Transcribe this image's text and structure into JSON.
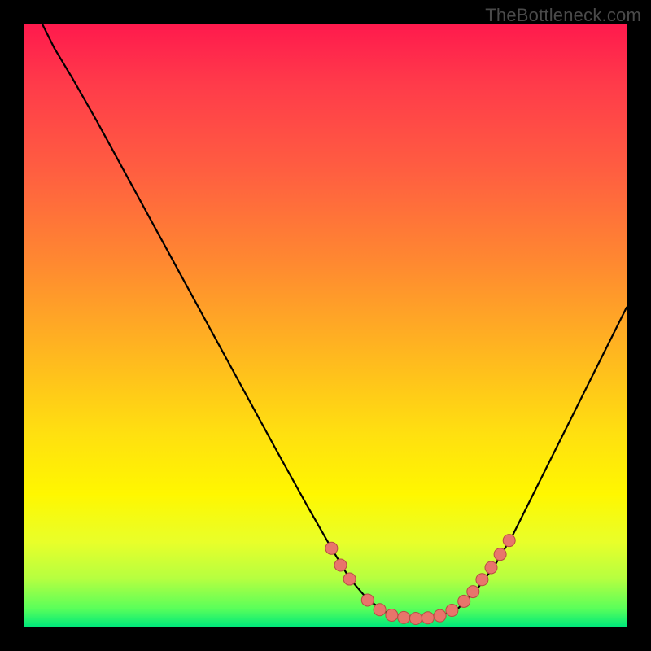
{
  "watermark": {
    "text": "TheBottleneck.com"
  },
  "colors": {
    "background": "#000000",
    "curve_stroke": "#000000",
    "dot_fill": "#e8756b",
    "dot_stroke": "#b84c44"
  },
  "chart_data": {
    "type": "line",
    "title": "",
    "xlabel": "",
    "ylabel": "",
    "xlim": [
      0,
      100
    ],
    "ylim": [
      0,
      100
    ],
    "grid": false,
    "legend": false,
    "annotations": [],
    "curve_points": [
      {
        "x": 3.0,
        "y": 100.0
      },
      {
        "x": 5.0,
        "y": 96.0
      },
      {
        "x": 8.0,
        "y": 91.0
      },
      {
        "x": 12.0,
        "y": 84.0
      },
      {
        "x": 18.0,
        "y": 73.0
      },
      {
        "x": 24.0,
        "y": 62.0
      },
      {
        "x": 30.0,
        "y": 51.0
      },
      {
        "x": 36.0,
        "y": 40.0
      },
      {
        "x": 42.0,
        "y": 29.0
      },
      {
        "x": 47.0,
        "y": 20.0
      },
      {
        "x": 51.0,
        "y": 13.0
      },
      {
        "x": 54.0,
        "y": 8.0
      },
      {
        "x": 57.0,
        "y": 4.5
      },
      {
        "x": 60.0,
        "y": 2.4
      },
      {
        "x": 63.0,
        "y": 1.6
      },
      {
        "x": 66.0,
        "y": 1.4
      },
      {
        "x": 69.0,
        "y": 1.7
      },
      {
        "x": 72.0,
        "y": 3.0
      },
      {
        "x": 75.0,
        "y": 6.0
      },
      {
        "x": 78.0,
        "y": 10.0
      },
      {
        "x": 81.0,
        "y": 15.0
      },
      {
        "x": 85.0,
        "y": 23.0
      },
      {
        "x": 90.0,
        "y": 33.0
      },
      {
        "x": 95.0,
        "y": 43.0
      },
      {
        "x": 100.0,
        "y": 53.0
      }
    ],
    "highlight_dots": [
      {
        "x": 51.0,
        "y": 13.0
      },
      {
        "x": 52.5,
        "y": 10.2
      },
      {
        "x": 54.0,
        "y": 7.9
      },
      {
        "x": 57.0,
        "y": 4.4
      },
      {
        "x": 59.0,
        "y": 2.8
      },
      {
        "x": 61.0,
        "y": 1.9
      },
      {
        "x": 63.0,
        "y": 1.5
      },
      {
        "x": 65.0,
        "y": 1.35
      },
      {
        "x": 67.0,
        "y": 1.45
      },
      {
        "x": 69.0,
        "y": 1.8
      },
      {
        "x": 71.0,
        "y": 2.7
      },
      {
        "x": 73.0,
        "y": 4.2
      },
      {
        "x": 74.5,
        "y": 5.8
      },
      {
        "x": 76.0,
        "y": 7.8
      },
      {
        "x": 77.5,
        "y": 9.8
      },
      {
        "x": 79.0,
        "y": 12.0
      },
      {
        "x": 80.5,
        "y": 14.3
      }
    ]
  }
}
